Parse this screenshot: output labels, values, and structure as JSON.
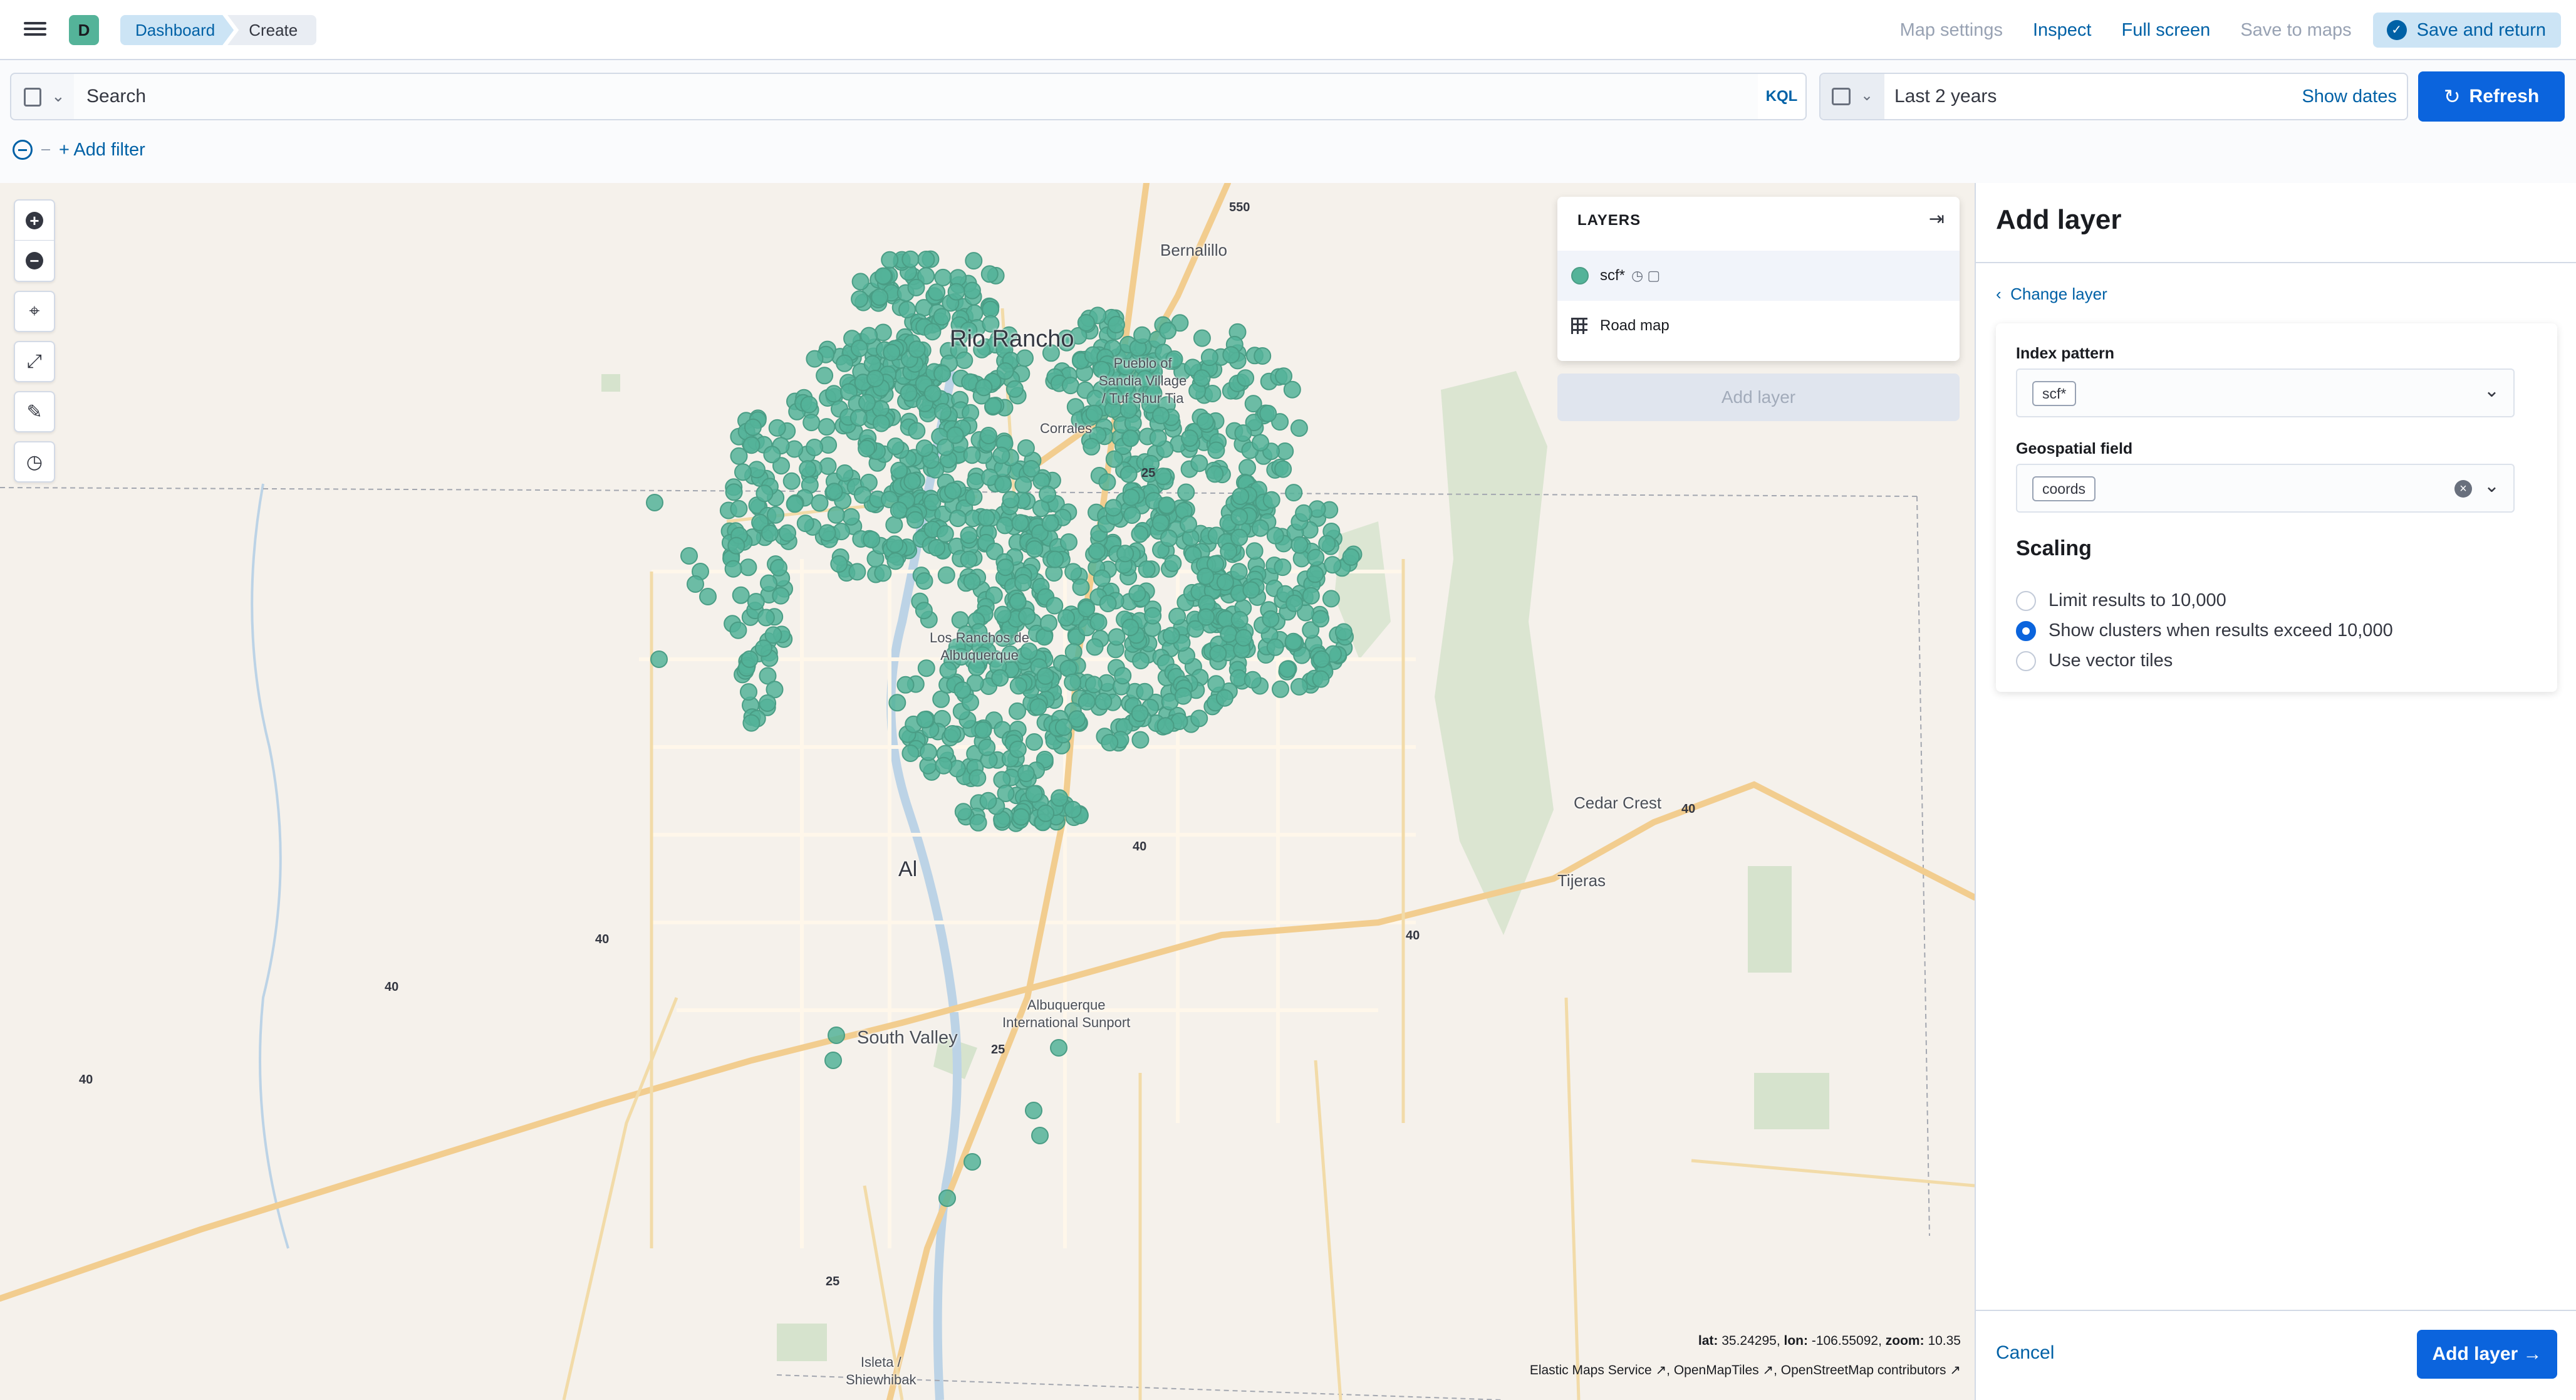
{
  "header": {
    "space_initial": "D",
    "breadcrumbs": [
      "Dashboard",
      "Create"
    ],
    "links": {
      "map_settings": "Map settings",
      "inspect": "Inspect",
      "full_screen": "Full screen",
      "save_to_maps": "Save to maps",
      "save_and_return": "Save and return"
    }
  },
  "query": {
    "search_placeholder": "Search",
    "language": "KQL",
    "date_range": "Last 2 years",
    "show_dates": "Show dates",
    "refresh": "Refresh",
    "add_filter": "+ Add filter"
  },
  "map": {
    "places": {
      "rio_rancho": "Rio Rancho",
      "bernalillo": "Bernalillo",
      "pueblo": "Pueblo of\nSandia Village\n/ Tuf Shur Tia",
      "corrales": "Corrales",
      "los_ranchos": "Los Ranchos de\nAlbuquerque",
      "cedar_crest": "Cedar Crest",
      "tijeras": "Tijeras",
      "south_valley": "South Valley",
      "sunport": "Albuquerque\nInternational Sunport",
      "isleta": "Isleta /\nShiewhibak",
      "albuquerque_partial": "Al"
    },
    "shields": [
      "550",
      "25",
      "40",
      "25",
      "25",
      "40",
      "40",
      "40",
      "40",
      "40"
    ],
    "layers_panel": {
      "title": "LAYERS",
      "layers": [
        {
          "name": "scf*",
          "color": "#54b399"
        },
        {
          "name": "Road map"
        }
      ],
      "add_layer": "Add layer"
    },
    "coordinates": {
      "lat_label": "lat:",
      "lat": "35.24295",
      "lon_label": "lon:",
      "lon": "-106.55092",
      "zoom_label": "zoom:",
      "zoom": "10.35"
    },
    "attribution": [
      "Elastic Maps Service",
      "OpenMapTiles",
      "OpenStreetMap contributors"
    ],
    "point_color": "#54b399"
  },
  "flyout": {
    "title": "Add layer",
    "change_layer": "Change layer",
    "index_pattern_label": "Index pattern",
    "index_pattern_value": "scf*",
    "geo_field_label": "Geospatial field",
    "geo_field_value": "coords",
    "scaling_title": "Scaling",
    "scaling_options": [
      {
        "label": "Limit results to 10,000",
        "checked": false
      },
      {
        "label": "Show clusters when results exceed 10,000",
        "checked": true
      },
      {
        "label": "Use vector tiles",
        "checked": false
      }
    ],
    "cancel": "Cancel",
    "add_layer": "Add layer"
  },
  "colors": {
    "primary": "#0b64dd",
    "link": "#0061a6",
    "accent": "#54b399",
    "map_bg": "#f5f1eb"
  }
}
